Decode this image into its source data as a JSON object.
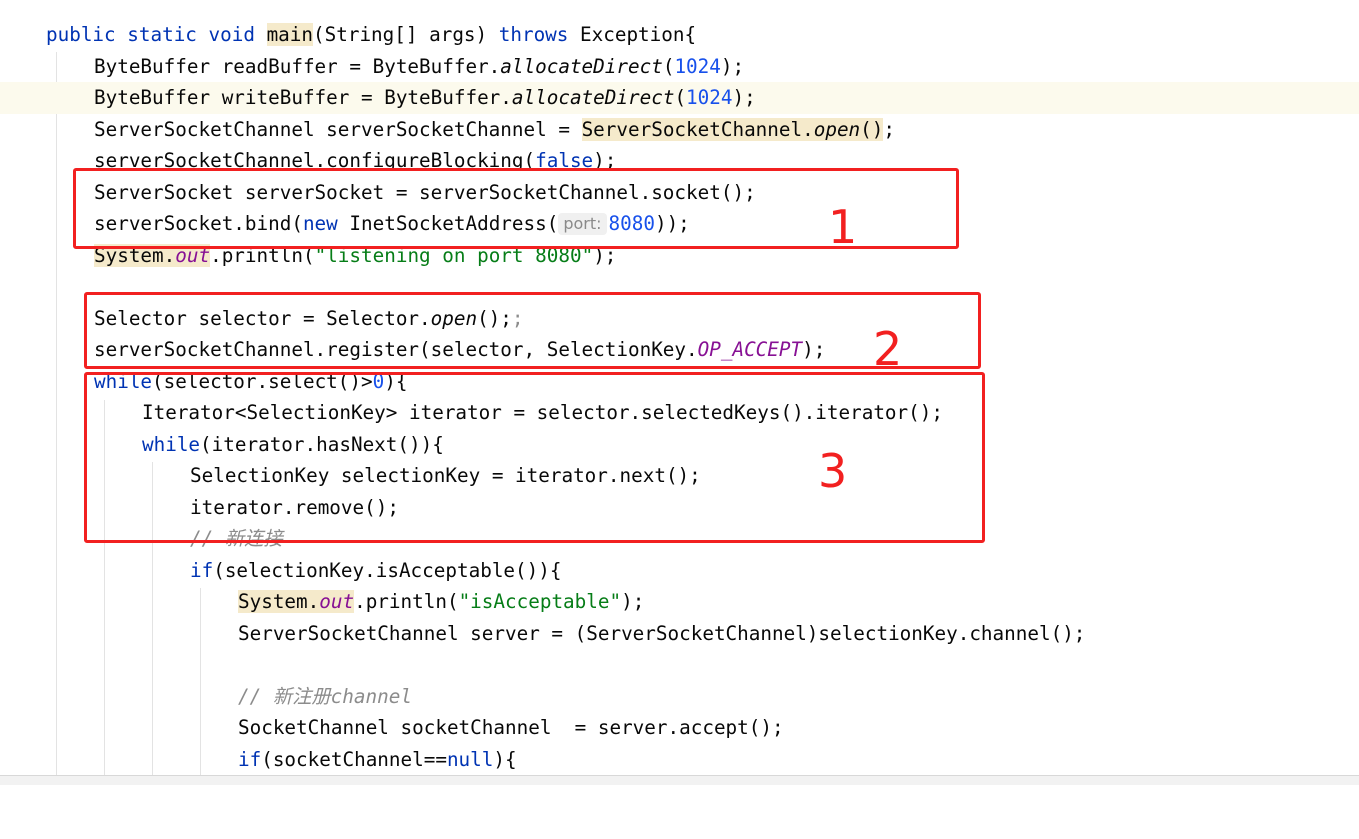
{
  "code": {
    "l01": [
      "public",
      "static",
      "void",
      "main",
      "(String[] args) ",
      "throws",
      " Exception{"
    ],
    "l02": [
      "ByteBuffer readBuffer = ByteBuffer.",
      "allocateDirect",
      "(",
      "1024",
      ");"
    ],
    "l03": [
      "ByteBuffer writeBuffer = ByteBuffer.",
      "allocateDirect",
      "(",
      "1024",
      ");"
    ],
    "l04": [
      "ServerSocketChannel serverSocketChannel = ",
      "ServerSocketChannel.",
      "open",
      "()",
      ";"
    ],
    "l05": [
      "serverSocketChannel.configureBlocking(",
      "false",
      ");"
    ],
    "l06": [
      "ServerSocket serverSocket = serverSocketChannel.socket();"
    ],
    "l07": [
      "serverSocket.bind(",
      "new",
      " InetSocketAddress(",
      "port:",
      "8080",
      "));"
    ],
    "l08": [
      "System.",
      "out",
      ".println(",
      "\"listening on port 8080\"",
      ");"
    ],
    "l10": [
      "Selector selector = Selector.",
      "open",
      "();",
      ";"
    ],
    "l11": [
      "serverSocketChannel.register(selector, SelectionKey.",
      "OP_ACCEPT",
      ");"
    ],
    "l12": [
      "while",
      "(selector.select()>",
      "0",
      "){"
    ],
    "l13": [
      "Iterator<SelectionKey> iterator = selector.selectedKeys().iterator();"
    ],
    "l14": [
      "while",
      "(iterator.hasNext()){"
    ],
    "l15": [
      "SelectionKey selectionKey = iterator.next();"
    ],
    "l16": [
      "iterator.remove();"
    ],
    "l17": [
      "// 新连接"
    ],
    "l18": [
      "if",
      "(selectionKey.isAcceptable()){"
    ],
    "l19": [
      "System.",
      "out",
      ".println(",
      "\"isAcceptable\"",
      ");"
    ],
    "l20": [
      "ServerSocketChannel server = (ServerSocketChannel)selectionKey.channel();"
    ],
    "l22": [
      "// 新注册channel"
    ],
    "l23": [
      "SocketChannel socketChannel  = server.accept();"
    ],
    "l24": [
      "if",
      "(socketChannel==",
      "null",
      "){"
    ]
  },
  "annotations": {
    "box1_label": "1",
    "box2_label": "2",
    "box3_label": "3",
    "color": "#f22020"
  }
}
